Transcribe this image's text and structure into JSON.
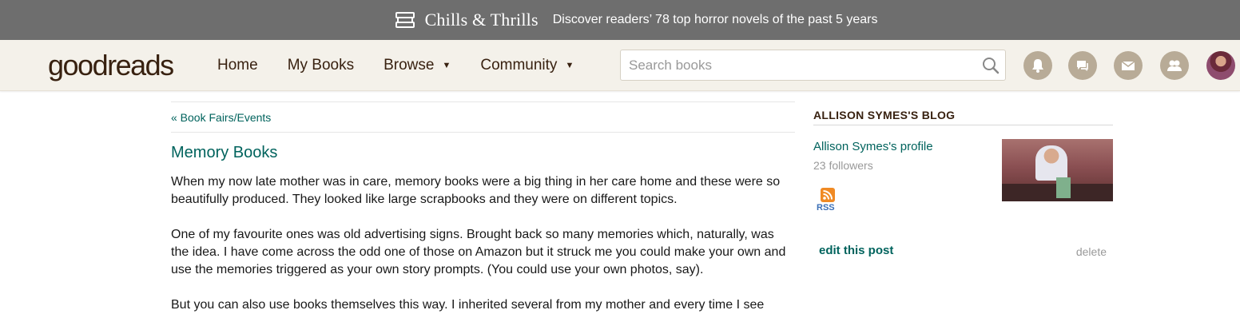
{
  "banner": {
    "icon": "bookshelf-icon",
    "title": "Chills & Thrills",
    "text": "Discover readers’ 78 top horror novels of the past 5 years"
  },
  "header": {
    "logo_light": "good",
    "logo_bold": "reads",
    "nav": {
      "home": "Home",
      "my_books": "My Books",
      "browse": "Browse",
      "community": "Community"
    },
    "search_placeholder": "Search books",
    "icons": [
      "notifications-icon",
      "discussions-icon",
      "messages-icon",
      "friends-icon"
    ]
  },
  "main": {
    "back_link": "« Book Fairs/Events",
    "post_title": "Memory Books",
    "paragraphs": [
      "When my now late mother was in care, memory books were a big thing in her care home and these were so beautifully produced. They looked like large scrapbooks and they were on different topics.",
      "One of my favourite ones was old advertising signs. Brought back so many memories which, naturally, was the idea. I have come across the odd one of those on Amazon but it struck me you could make your own and use the memories triggered as your own story prompts. (You could use your own photos, say).",
      "But you can also use books themselves this way. I inherited several from my mother and every time I see"
    ]
  },
  "sidebar": {
    "title": "ALLISON SYMES'S BLOG",
    "profile_link": "Allison Symes's profile",
    "followers": "23 followers",
    "rss_label": "RSS",
    "edit_post": "edit this post",
    "delete_post": "delete"
  },
  "colors": {
    "banner_bg": "#6e6e6e",
    "header_bg": "#f4f1ea",
    "link_green": "#00635d",
    "brand_brown": "#382110",
    "icon_tan": "#b8ab97"
  }
}
